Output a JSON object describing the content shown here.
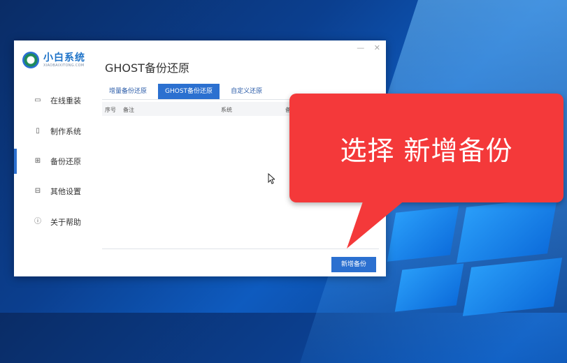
{
  "app": {
    "logo_title": "小白系统",
    "logo_subtitle": "XIAOBAIXITONG.COM"
  },
  "window": {
    "controls": [
      "—",
      "✕"
    ]
  },
  "sidebar": {
    "items": [
      {
        "label": "在线重装",
        "icon": "monitor-icon"
      },
      {
        "label": "制作系统",
        "icon": "usb-icon"
      },
      {
        "label": "备份还原",
        "icon": "grid-icon"
      },
      {
        "label": "其他设置",
        "icon": "briefcase-icon"
      },
      {
        "label": "关于帮助",
        "icon": "info-icon"
      }
    ],
    "active_index": 2
  },
  "main": {
    "title": "GHOST备份还原",
    "tabs": [
      {
        "label": "增量备份还原",
        "active": false
      },
      {
        "label": "GHOST备份还原",
        "active": true
      },
      {
        "label": "自定义还原",
        "active": false
      }
    ],
    "table": {
      "columns": [
        "序号",
        "备注",
        "系统",
        "备"
      ]
    },
    "new_backup_button": "新增备份"
  },
  "callout": {
    "text": "选择 新增备份",
    "color": "#f4393a"
  },
  "colors": {
    "accent": "#2b70d0",
    "logo": "#1e73c8"
  }
}
